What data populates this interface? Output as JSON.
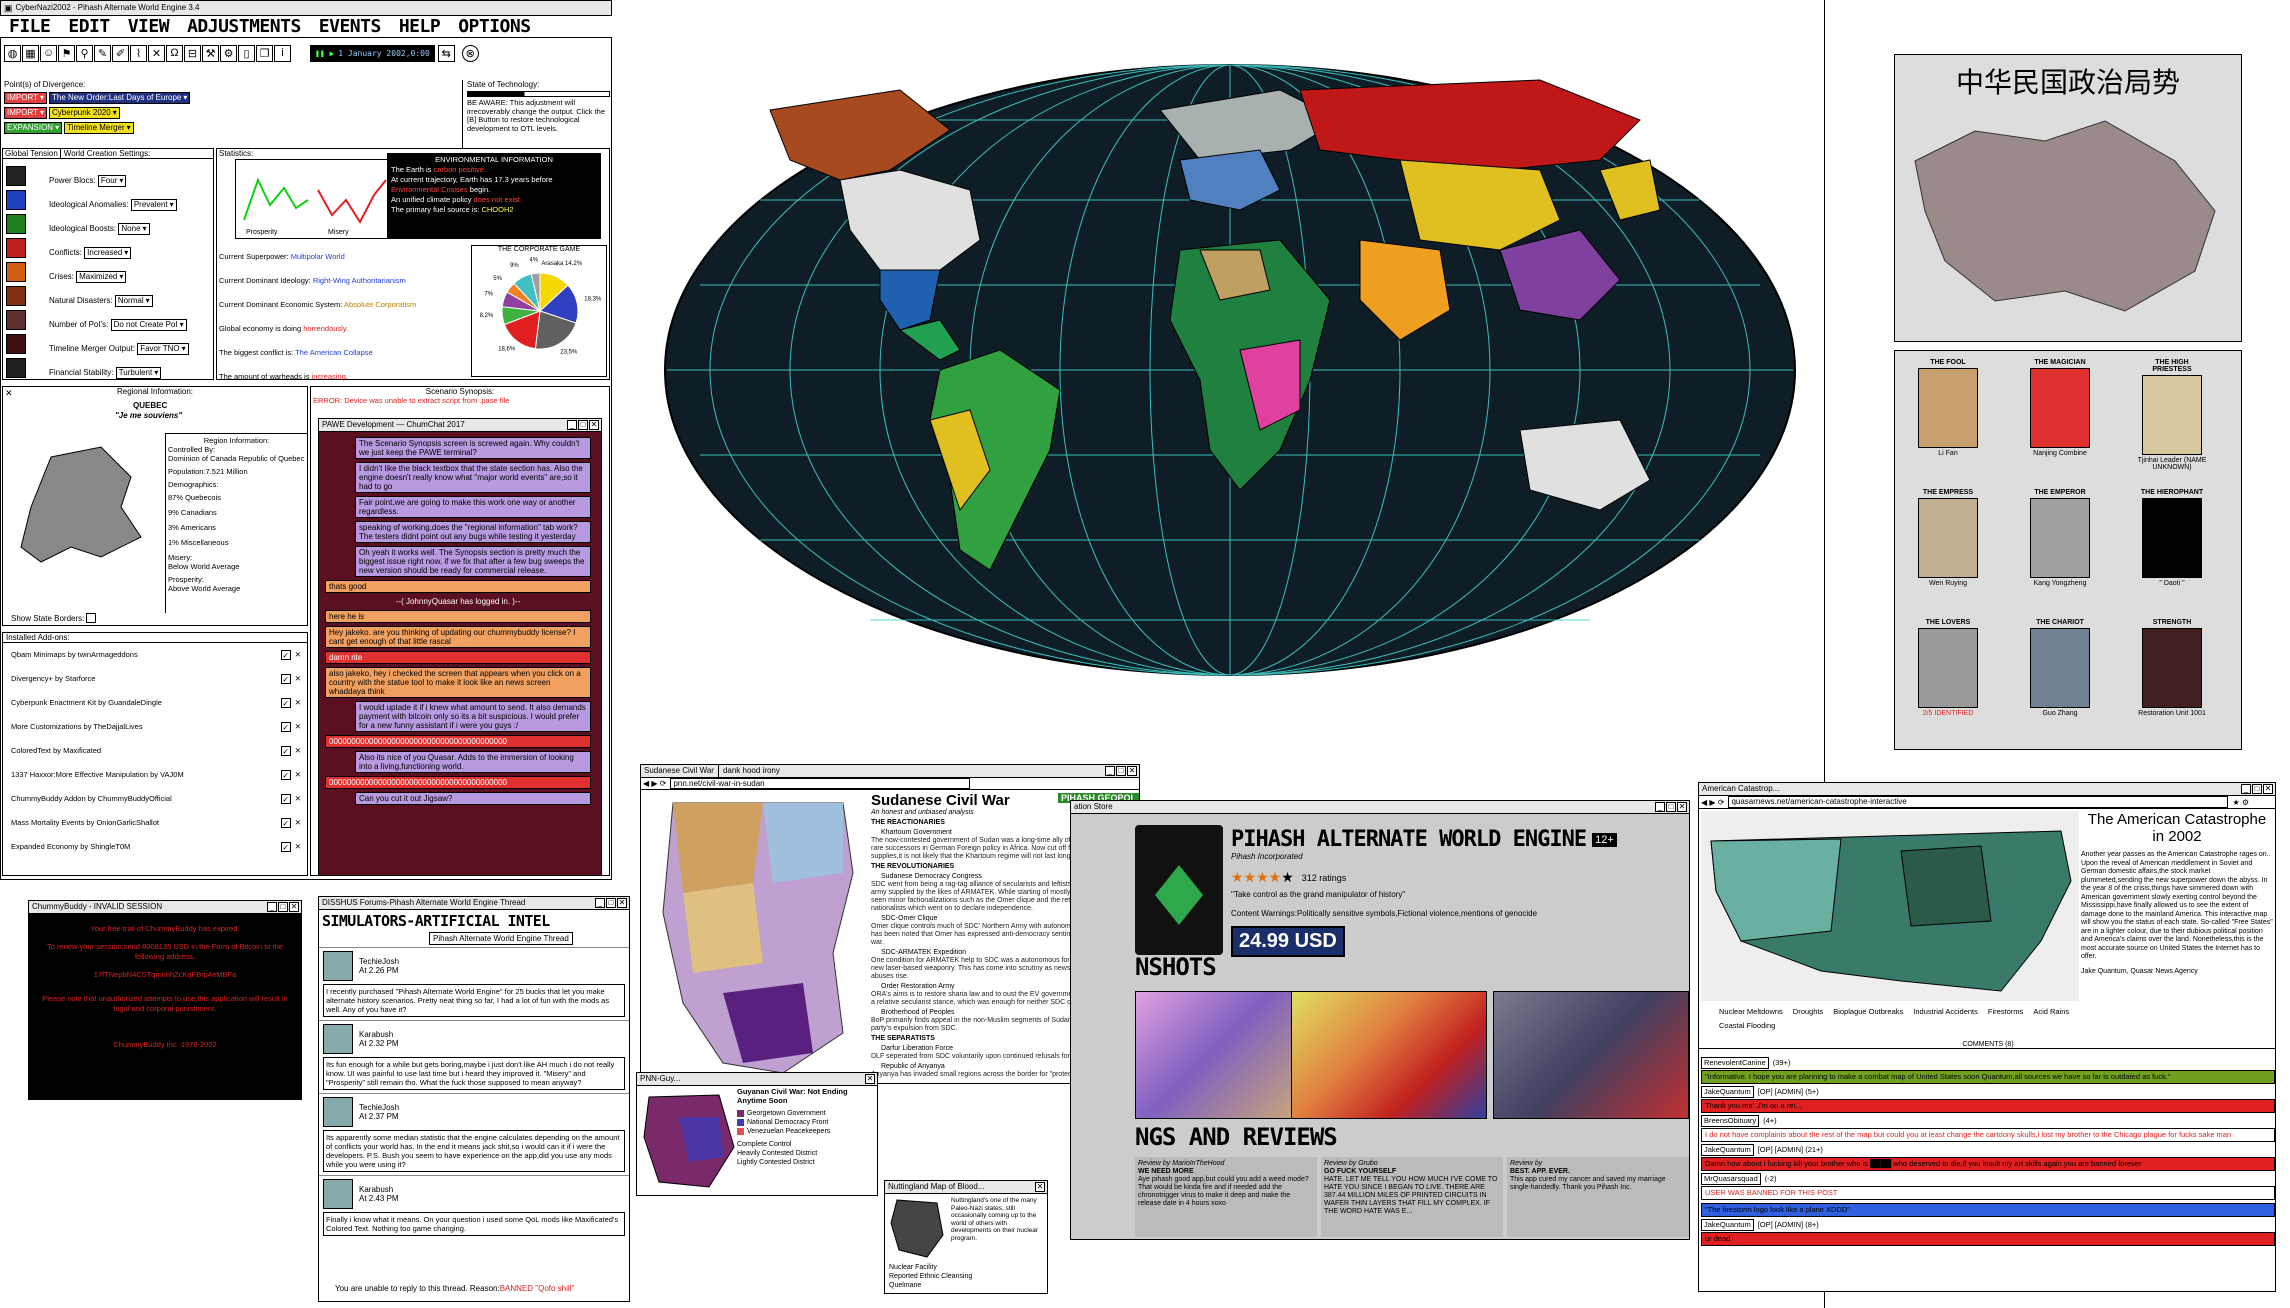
{
  "window": {
    "title": "CyberNazi2002 - Pihash Alternate World Engine 3.4"
  },
  "menu": [
    "FILE",
    "EDIT",
    "VIEW",
    "ADJUSTMENTS",
    "EVENTS",
    "HELP",
    "OPTIONS"
  ],
  "toolbar": {
    "date": "1 January 2002,0:00"
  },
  "divergence": {
    "label": "Point(s) of Divergence:",
    "rows": [
      {
        "tag": "IMPORT",
        "value": "The New Order:Last Days of Europe"
      },
      {
        "tag": "IMPORT",
        "value": "Cyberpunk 2020"
      },
      {
        "tag": "EXPANSION",
        "value": "Timeline Merger"
      }
    ]
  },
  "technology": {
    "label": "State of Technology:",
    "warning": "BE AWARE: This adjustment will irrecoverably change the output. Click the [B] Button to restore technological development to OTL levels."
  },
  "tabs": {
    "global": "Global Tension",
    "creation": "World Creation Settings:"
  },
  "settings": [
    {
      "label": "Power Blocs:",
      "value": "Four"
    },
    {
      "label": "Ideological Anomalies:",
      "value": "Prevalent"
    },
    {
      "label": "Ideological Boosts:",
      "value": "None"
    },
    {
      "label": "Conflicts:",
      "value": "Increased"
    },
    {
      "label": "Crises:",
      "value": "Maximized"
    },
    {
      "label": "Natural Disasters:",
      "value": "Normal"
    },
    {
      "label": "Number of PoI's:",
      "value": "Do not Create PoI"
    },
    {
      "label": "Timeline Merger Output:",
      "value": "Favor TNO"
    },
    {
      "label": "Financial Stability:",
      "value": "Turbulent"
    }
  ],
  "statistics": {
    "label": "Statistics:",
    "prosperity": "Prosperity",
    "misery": "Misery"
  },
  "environment": {
    "header": "ENVIRONMENTAL INFORMATION",
    "l1a": "The Earth is ",
    "l1b": "carbon positive.",
    "l2a": "At current trajectory, Earth has 17.3 years before ",
    "l2b": "Environmental Crisises",
    "l2c": " begin.",
    "l3a": "An unified climate policy ",
    "l3b": "does not exist.",
    "l4a": "The primary fuel source is: ",
    "l4b": "CHOOH2"
  },
  "status": [
    {
      "a": "Current Superpower: ",
      "b": "Multipolar World"
    },
    {
      "a": "Current Dominant Ideology: ",
      "b": "Right-Wing Authoritarianism"
    },
    {
      "a": "Current Dominant Economic System: ",
      "b": "Absolute Corporatism"
    },
    {
      "a": "Global economy is doing ",
      "b": "horrendously."
    },
    {
      "a": "The biggest conflict is: ",
      "b": "The American Collapse"
    },
    {
      "a": "The amount of warheads is ",
      "b": "increasing."
    }
  ],
  "corporate": {
    "title": "THE CORPORATE GAME",
    "labels": [
      "Arasaka 14,2%",
      "18,3%",
      "23,5%",
      "18,6%",
      "8,2%",
      "7%",
      "5%",
      "9%",
      "4%",
      "?"
    ]
  },
  "chart_data": {
    "type": "pie",
    "title": "THE CORPORATE GAME",
    "values": [
      14.2,
      18.3,
      23.5,
      18.6,
      8.2,
      7,
      5,
      9,
      4
    ],
    "colors": [
      "#f5d800",
      "#3040c0",
      "#606060",
      "#e02020",
      "#40b040",
      "#9040a0",
      "#f08020",
      "#40c0c0",
      "#a0a0a0"
    ]
  },
  "regional": {
    "header": "Regional Information:",
    "name": "QUEBEC",
    "motto": "\"Je me souviens\"",
    "info_header": "Region Information:",
    "controlled": "Controlled By:",
    "controller": "Dominion of Canada Republic of Quebec",
    "population": "Population:7.521 Million",
    "demo": "Demographics:",
    "d1": "87% Quebecois",
    "d2": "9% Canadians",
    "d3": "3% Americans",
    "d4": "1% Miscellaneous",
    "misery": "Misery:",
    "misery_v": "Below World Average",
    "prosperity": "Prosperity:",
    "prosperity_v": "Above World Average",
    "borders": "Show State Borders:"
  },
  "scenario": {
    "header": "Scenario Synopsis:",
    "error": "ERROR: Device was unable to extract script from .pase file"
  },
  "chat": {
    "title": "PAWE Development — ChumChat 2017",
    "msgs": [
      {
        "c": "purple",
        "t": "The Scenario Synopsis screen is screwed again. Why couldn't we just keep the PAWE terminal?"
      },
      {
        "c": "purple",
        "t": "I didn't like the black textbox that the state section has. Also the engine doesn't really know what \"major world events\" are,so it had to go"
      },
      {
        "c": "purple",
        "t": "Fair point,we are going to make this work one way or another regardless."
      },
      {
        "c": "purple",
        "t": "speaking of working,does the \"regional information\" tab work? The testers didnt point out any bugs while testing it yesterday"
      },
      {
        "c": "purple",
        "t": "Oh yeah it works well. The Synopsis section is pretty much the biggest issue right now, if we fix that after a few bug sweeps the new version should be ready for commercial release."
      },
      {
        "c": "orange",
        "t": "thats good"
      },
      {
        "c": "none",
        "t": "--( JohnnyQuasar has logged in. )--"
      },
      {
        "c": "orange",
        "t": "here he is"
      },
      {
        "c": "orange",
        "t": "Hey jakeko. are you thinking of updating our chummybuddy license? I cant get enough of that little rascal"
      },
      {
        "c": "red",
        "t": "damn rite"
      },
      {
        "c": "orange",
        "t": "also jakeko, hey i checked the screen that appears when you click on a country with the statue tool to make it look like an news screen whaddaya think"
      },
      {
        "c": "purple",
        "t": "I would uptade it if i knew what amount to send. It also demands payment with bitcoin only so its a bit suspicious. I would prefer for a new funny assistant if i were you guys :/"
      },
      {
        "c": "red",
        "t": "0000000000000000000000000000000000000000"
      },
      {
        "c": "purple",
        "t": "Also its nice of you Quasar. Adds to the immersion of looking into a living,functioning world."
      },
      {
        "c": "red",
        "t": "0000000000000000000000000000000000000000"
      },
      {
        "c": "purple",
        "t": "Can you cut it out Jigsaw?"
      }
    ]
  },
  "addons": {
    "header": "Installed Add-ons:",
    "items": [
      "Qbam Minimaps by twinArmageddons",
      "Divergency+ by Starforce",
      "Cyberpunk Enactment Kit by GuandaleDingle",
      "More Customizations by TheDajjalLives",
      "ColoredText by Maxificated",
      "1337 Haxxor:More Effective Manipulation by VAJ0M",
      "ChummyBuddy Addon by ChummyBuddyOfficial",
      "Mass Mortality Events by OnionGarlicShallot",
      "Expanded Economy by ShingleT0M"
    ]
  },
  "chummy": {
    "title": "ChummyBuddy - INVALID SESSION",
    "l1": "Your free trial of ChummyBuddy has expired.",
    "l2": "To renew your session,send 8008135 USD in the Form of Bitcoin to the following address.",
    "l3": "17fTNepbN4CSTqmnhhZcKqFBrp4eMBFa",
    "l4": "Please note that unauthorized attempts to use this application will result in legal and corporal punishment.",
    "l5": "ChummyBuddy Inc. 1976-2002"
  },
  "forum": {
    "title": "DISSHUS Forums-Pihash Alternate World Engine Thread",
    "heading": "SIMULATORS-ARTIFICIAL INTEL",
    "thread": "Pihash Alternate World Engine Thread",
    "posts": [
      {
        "user": "TechieJosh",
        "time": "At 2.26 PM",
        "text": "I recently purchased \"Pihash Alternate World Engine\" for 25 bucks that let you make alternate history scenarios. Pretty neat thing so far, I had a lot of fun with the mods as well. Any of you have it?"
      },
      {
        "user": "Karabush",
        "time": "At 2.32 PM",
        "text": "Its fun enough for a while but gets boring,maybe i just don't like AH much i do not really know. UI was painful to use last time but i heard they improved it. \"Misery\" and \"Prosperity\" still remain tho. What the fuck those supposed to mean anyway?"
      },
      {
        "user": "TechieJosh",
        "time": "At 2.37 PM",
        "text": "Its apparently some median statistic that the engine calculates depending on the amount of conflicts your world has. In the end it means jack shit,so i would can it if i were the developers. P.S. Bush you seem to have experience on the app,did you use any mods while you were using it?"
      },
      {
        "user": "Karabush",
        "time": "At 2.43 PM",
        "text": "Finally i know what it means. On your question i used some QoL mods like Maxificated's Colored Text. Nothing too game changing."
      }
    ],
    "footer": "You are unable to reply to this thread. Reason:",
    "reason": "BANNED \"Qofo shill\""
  },
  "sudan": {
    "tab1": "Sudanese Civil War",
    "tab2": "dank hood irony",
    "url": "pnn.net/civil-war-in-sudan",
    "brand": "PIHASH GEOPOL",
    "title": "Sudanese Civil War",
    "subtitle": "An honest and unbiased analysis",
    "sections": [
      {
        "h": "THE REACTIONARIES",
        "items": [
          "Khartoum Government",
          "The now-contested government of Sudan was a long-time ally of EV and one of the rare successors in German Foreign policy in Africa. Now cut off from allies and supplies,it is not likely that the Khartoum regime will not last long."
        ]
      },
      {
        "h": "THE REVOLUTIONARIES",
        "items": [
          "Sudanese Democracy Congress",
          "SDC went from being a rag-tag alliance of secularists and leftists into a formidable army supplied by the likes of ARMATEK. While starting of mostly unified,SDC has seen minor factionalizations such as the Omer clique and the retraction of Darfur nationalists which went on to declare independence.",
          "SDC-Omer Clique",
          "Omer clique controls much of SDC' Northern Army with autonomy given to them. It has been noted that Omer has expressed anti-democracy sentiments before the civil war.",
          "SDC-ARMATEK Expedition",
          "One condition for ARMATEK help to SDC was a autonomous force being used to test new laser-based weaponry. This has come into scrutiny as news of human rights abuses rise.",
          "Order Restoration Army",
          "ORA's aims is to restore sharia law and to oust the EV government,which has followed a relative secularist stance, which was enough for neither SDC or ORA.",
          "Brotherhood of Peoples",
          "BoP primarily finds appeal in the non-Muslim segments of Sudan,which led to the party's expulsion from SDC."
        ]
      },
      {
        "h": "THE SEPARATISTS",
        "items": [
          "Darfur Liberation Force",
          "DLF seperated from SDC voluntarily upon continued refusals for autonomy.",
          "Republic of Anyanya",
          "Anyanya has invaded small regions across the border for \"protecting border integrity\"."
        ]
      }
    ]
  },
  "guyana": {
    "tab": "PNN-Guy...",
    "title": "Guyanan Civil War: Not Ending Anytime Soon",
    "legend": [
      "Georgetown Government",
      "National Democracy Front",
      "Venezuelan Peacekeepers"
    ],
    "legend2": [
      "Complete Control",
      "Heavily Contested District",
      "Lightly Contested District"
    ]
  },
  "nutt": {
    "title": "Nuttingland Map of Blood...",
    "text": "Nuttingland's one of the many Paleo-Nazi states, still occasionally coming up to the world of others with developments on their nuclear program.",
    "legend": [
      "Nuclear Facility",
      "Reported Ethnic Cleansing",
      "Quelmane"
    ]
  },
  "store": {
    "tab": "ation Store",
    "name": "PIHASH ALTERNATE WORLD ENGINE",
    "age": "12+",
    "publisher": "Pihash Incorporated",
    "ratings": "312 ratings",
    "tagline": "\"Take control as the grand manipulator of history\"",
    "warnings": "Content Warnings:Politically sensitive symbols,Fictional violence,mentions of genocide",
    "price": "24.99 USD",
    "shots": "NSHOTS",
    "reviews": "NGS AND REVIEWS",
    "review_list": [
      {
        "by": "Review by MarioInTheHood",
        "h": "WE NEED MORE",
        "t": "Aye pihash good app,but could you add a weed mode? That would be kinda fire and if needed add the chronotrigger virus to make it deep and make the release date in 4 hours xoxo"
      },
      {
        "by": "Review by Grubo",
        "h": "GO FUCK YOURSELF",
        "t": "HATE. LET ME TELL YOU HOW MUCH I'VE COME TO HATE YOU SINCE I BEGAN TO LIVE. THERE ARE 387.44 MILLION MILES OF PRINTED CIRCUITS IN WAFER THIN LAYERS THAT FILL MY COMPLEX. IF THE WORD HATE WAS E..."
      },
      {
        "by": "Review by",
        "h": "BEST. APP. EVER.",
        "t": "This app cured my cancer and saved my marriage single-handedly. Thank you Pihash Inc."
      }
    ]
  },
  "american": {
    "tab": "American Catastrop...",
    "url": "quasarnews.net/american-catastrophe-interactive",
    "title": "The American Catastrophe in 2002",
    "body": "Another year passes as the American Catastrophe rages on.. Upon the reveal of American meddlement in Soviet and German domestic affairs,the stock market plummeted,sending the new superpower down the abyss. In the year 8 of the crisis,things have simmered down with American government slowly exerting control beyond the Mississippi,have finally allowed us to see the extent of damage done to the mainland America. This interactive map will show you the status of each state. So-called \"Free States\" are in a lighter colour, due to their dubious political position and America's claims over the land. Nonetheless,this is the most accurate source on United States the Internet has to offer.",
    "byline": "Jake Quantum, Quasar News Agency",
    "legend": [
      "Nuclear Meltdowns",
      "Droughts",
      "Bioplague Outbreaks",
      "Industrial Accidents",
      "Firestorms",
      "Acid Rains",
      "Coastal Flooding"
    ],
    "comments": "COMMENTS (8)",
    "comment_list": [
      {
        "u": "RenevolentCanine",
        "s": "(39+)",
        "t": "\"Informative. I hope you are planning to make a combat map of United States soon Quantum,all sources we have so far is outdated as fuck.\""
      },
      {
        "u": "JakeQuantum",
        "s": "[OP] [ADMIN] (5+)",
        "t": "Thank you ma' ,I'm on a ret..."
      },
      {
        "u": "BreensObituary",
        "s": "(4+)",
        "t": "I do not have complaints about the rest of the map but could you at least change the cartoony skulls,i lost my brother to the Chicago plague for fucks sake man"
      },
      {
        "u": "JakeQuantum",
        "s": "[OP] [ADMIN] (21+)",
        "t": "Damn how about i fucking kill your brother who is ████ who deserved to die,if you insult my art skills again you are banned forever"
      },
      {
        "u": "MrQuasarsquad",
        "s": "(-2)",
        "t": "USER WAS BANNED FOR THIS POST"
      },
      {
        "u": "",
        "s": "",
        "t": "\"The firestorm logo look like a plane XDDD\""
      },
      {
        "u": "JakeQuantum",
        "s": "[OP] [ADMIN] (8+)",
        "t": "ur dead"
      }
    ]
  },
  "china": {
    "title": "中华民国政治局势",
    "cards": [
      {
        "t": "THE FOOL",
        "n": "Li Fan"
      },
      {
        "t": "THE MAGICIAN",
        "n": "Nanjing Combine"
      },
      {
        "t": "THE HIGH PRIESTESS",
        "n": "Tjinhai Leader (NAME UNKNOWN)"
      },
      {
        "t": "THE EMPRESS",
        "n": "Wen Ruying"
      },
      {
        "t": "THE EMPEROR",
        "n": "Kang Yongzheng"
      },
      {
        "t": "THE HIEROPHANT",
        "n": "\" Daoti \""
      },
      {
        "t": "THE LOVERS",
        "n": "2/5 IDENTIFIED"
      },
      {
        "t": "THE CHARIOT",
        "n": "Guo Zhang"
      },
      {
        "t": "STRENGTH",
        "n": "Restoration Unit 1001"
      }
    ]
  }
}
